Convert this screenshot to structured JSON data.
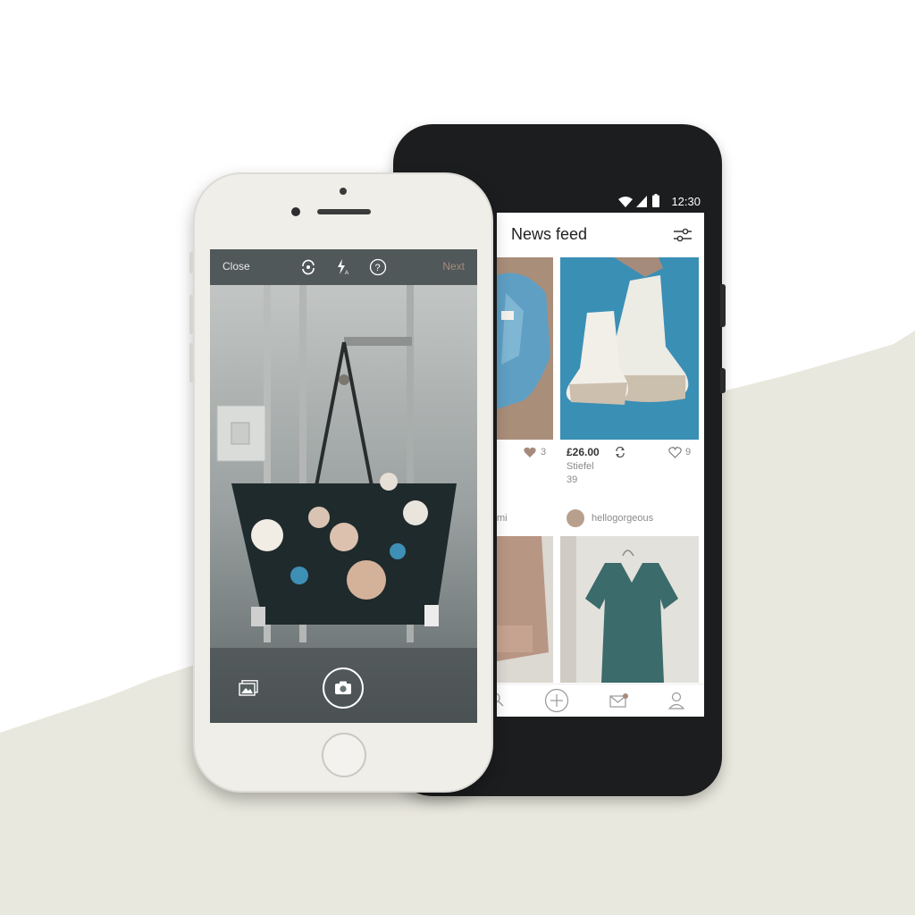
{
  "camera": {
    "close_label": "Close",
    "next_label": "Next",
    "icons": [
      "rotate-icon",
      "flash-auto-icon",
      "help-icon",
      "gallery-icon",
      "camera-icon"
    ]
  },
  "android": {
    "status": {
      "time": "12:30"
    },
    "feed": {
      "title": "News feed",
      "items": [
        {
          "likes": "3",
          "partial_user": "mi"
        },
        {
          "price": "£26.00",
          "brand": "Stiefel",
          "size": "39",
          "likes": "9",
          "user": "hellogorgeous"
        }
      ]
    },
    "nav_icons": [
      "search-icon",
      "add-icon",
      "inbox-icon",
      "profile-icon"
    ]
  },
  "colors": {
    "accent": "#a58b7b",
    "background_wash": "#e9e8de",
    "boot_backdrop": "#3a8fb5",
    "dress": "#3b6b6a"
  }
}
